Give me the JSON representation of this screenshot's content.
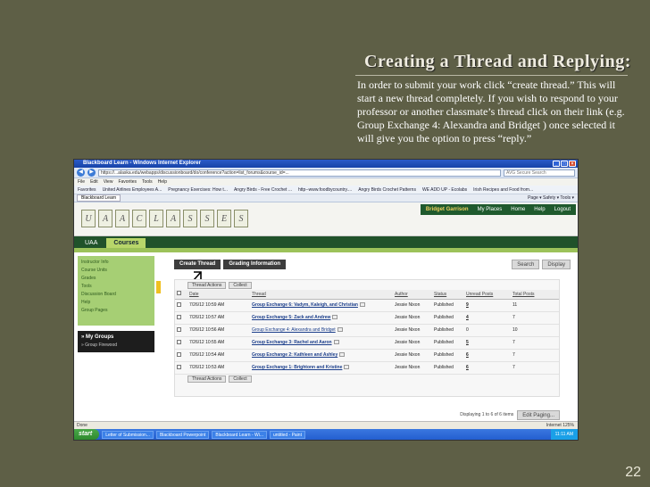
{
  "slide": {
    "title": "Creating a Thread and Replying:",
    "body": "In order to submit your work click “create thread.” This will start a new thread completely. If you wish to respond to your professor or another classmate’s thread click on their link (e.g. Group Exchange 4: Alexandra and Bridget ) once selected it will give you the option to press “reply.”",
    "page_number": "22"
  },
  "browser": {
    "window_title": "Blackboard Learn - Windows Internet Explorer",
    "address": "https://...alaska.edu/webapps/discussionboard/do/conference?action=list_forums&course_id=...",
    "search_placeholder": "AVG Secure Search",
    "menu": [
      "File",
      "Edit",
      "View",
      "Favorites",
      "Tools",
      "Help"
    ],
    "favorites": [
      "Favorites",
      "United Airlines Employees A...",
      "Pregnancy Exercises: How t...",
      "Angry Birds - Free Crochet ...",
      "http--www.foodbycountry....",
      "Angry Birds Crochet Patterns",
      "WE ADD UP - Ecolabs",
      "Irish Recipes and Food from..."
    ],
    "tab_label": "Blackboard Learn",
    "tab_tools": "Page ▾  Safety ▾  Tools ▾",
    "status_text": "Done",
    "status_right": "Internet    125%"
  },
  "blackboard": {
    "logo_letters": [
      "U",
      "A",
      "A",
      "C",
      "L",
      "A",
      "S",
      "S",
      "E",
      "S"
    ],
    "user_name": "Bridget Garrison",
    "top_nav": [
      "My Places",
      "Home",
      "Help",
      "Logout"
    ],
    "tabs": [
      "UAA",
      "Courses"
    ],
    "left_menu": [
      "Instructor Info",
      "Course Units",
      "Grades",
      "Tools",
      "Discussion Board",
      "Help",
      "Group Pages"
    ],
    "groups_label": "» My Groups",
    "group_name": "» Group Firewood",
    "create_thread": "Create Thread",
    "grading_info": "Grading Information",
    "search_label": "Search",
    "display_label": "Display",
    "thread_actions": "Thread Actions",
    "collect": "Collect",
    "columns": [
      "Date",
      "Thread",
      "Author",
      "Status",
      "Unread Posts",
      "Total Posts"
    ],
    "rows": [
      {
        "date": "7/26/12 10:59 AM",
        "thread": "Group Exchange 6: Vadym, Kaleigh, and Christian",
        "author": "Jessie Nixon",
        "status": "Published",
        "unread": "9",
        "total": "11"
      },
      {
        "date": "7/26/12 10:57 AM",
        "thread": "Group Exchange 5: Zack and Andrew",
        "author": "Jessie Nixon",
        "status": "Published",
        "unread": "4",
        "total": "7"
      },
      {
        "date": "7/26/12 10:56 AM",
        "thread": "Group Exchange 4: Alexandra and Bridget",
        "author": "Jessie Nixon",
        "status": "Published",
        "unread": "0",
        "total": "10"
      },
      {
        "date": "7/26/12 10:55 AM",
        "thread": "Group Exchange 3: Rachel and Aaron",
        "author": "Jessie Nixon",
        "status": "Published",
        "unread": "5",
        "total": "7"
      },
      {
        "date": "7/26/12 10:54 AM",
        "thread": "Group Exchange 2: Kathleen and Ashley",
        "author": "Jessie Nixon",
        "status": "Published",
        "unread": "6",
        "total": "7"
      },
      {
        "date": "7/26/12 10:53 AM",
        "thread": "Group Exchange 1: Brightonn and Kristine",
        "author": "Jessie Nixon",
        "status": "Published",
        "unread": "6",
        "total": "7"
      }
    ],
    "pager_text": "Displaying 1 to 6 of 6 items",
    "edit_paging": "Edit Paging..."
  },
  "taskbar": {
    "start": "start",
    "items": [
      "Letter of Submission...",
      "Blackboard Powerpoint",
      "Blackboard Learn - Wi...",
      "untitled - Paint"
    ],
    "clock": "11:11 AM"
  },
  "colors": {
    "slide_bg": "#5e5f46",
    "bb_green": "#20522a",
    "bb_light_green": "#a6cf74"
  }
}
